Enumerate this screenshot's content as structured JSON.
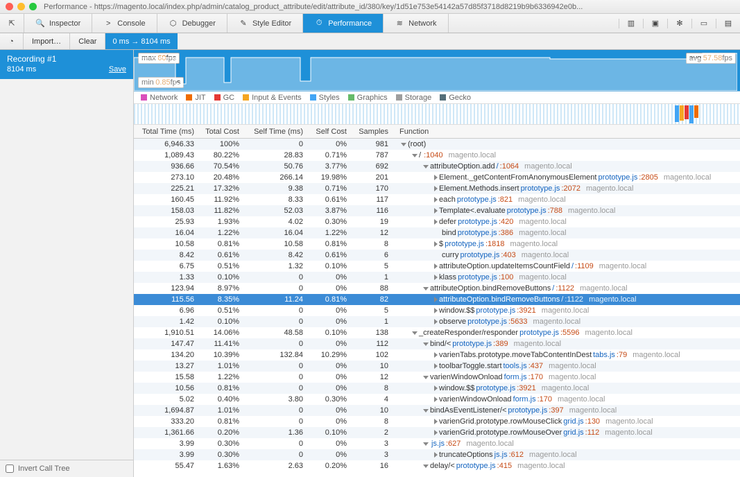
{
  "title": "Performance - https://magento.local/index.php/admin/catalog_product_attribute/edit/attribute_id/380/key/1d51e753e54142a57d85f3718d8219b9b6336942e0b...",
  "tabs": [
    "Inspector",
    "Console",
    "Debugger",
    "Style Editor",
    "Performance",
    "Network"
  ],
  "activeTab": 4,
  "bar2": {
    "import": "Import…",
    "clear": "Clear",
    "range": "0 ms → 8104 ms"
  },
  "recording": {
    "name": "Recording #1",
    "duration": "8104 ms",
    "save": "Save"
  },
  "fps": {
    "max_label": "max",
    "max": "60",
    "min_label": "min",
    "min": "0.85",
    "avg_label": "avg",
    "avg": "57.58",
    "unit": "fps"
  },
  "legend": [
    {
      "c": "#d94fbb",
      "t": "Network"
    },
    {
      "c": "#ef6c00",
      "t": "JIT"
    },
    {
      "c": "#e53935",
      "t": "GC"
    },
    {
      "c": "#f5a623",
      "t": "Input & Events"
    },
    {
      "c": "#42a5f5",
      "t": "Styles"
    },
    {
      "c": "#66bb6a",
      "t": "Graphics"
    },
    {
      "c": "#9e9e9e",
      "t": "Storage"
    },
    {
      "c": "#546e7a",
      "t": "Gecko"
    }
  ],
  "columns": [
    "Total Time (ms)",
    "Total Cost",
    "Self Time (ms)",
    "Self Cost",
    "Samples",
    "Function"
  ],
  "rows": [
    {
      "tt": "6,946.33",
      "tc": "100%",
      "st": "0",
      "sc": "0%",
      "sm": "981",
      "ind": 0,
      "arr": "down",
      "fn": "(root)"
    },
    {
      "tt": "1,089.43",
      "tc": "80.22%",
      "st": "28.83",
      "sc": "0.71%",
      "sm": "787",
      "ind": 1,
      "arr": "down",
      "fn": "/",
      "src": "",
      "ln": ":1040",
      "host": "magento.local"
    },
    {
      "tt": "936.66",
      "tc": "70.54%",
      "st": "50.76",
      "sc": "3.77%",
      "sm": "692",
      "ind": 2,
      "arr": "down",
      "fn": "attributeOption.add ",
      "src": "/",
      "ln": ":1064",
      "host": "magento.local"
    },
    {
      "tt": "273.10",
      "tc": "20.48%",
      "st": "266.14",
      "sc": "19.98%",
      "sm": "201",
      "ind": 3,
      "arr": "right",
      "fn": "Element._getContentFromAnonymousElement ",
      "src": "prototype.js",
      "ln": ":2805",
      "host": "magento.local"
    },
    {
      "tt": "225.21",
      "tc": "17.32%",
      "st": "9.38",
      "sc": "0.71%",
      "sm": "170",
      "ind": 3,
      "arr": "right",
      "fn": "Element.Methods.insert ",
      "src": "prototype.js",
      "ln": ":2072",
      "host": "magento.local"
    },
    {
      "tt": "160.45",
      "tc": "11.92%",
      "st": "8.33",
      "sc": "0.61%",
      "sm": "117",
      "ind": 3,
      "arr": "right",
      "fn": "each ",
      "src": "prototype.js",
      "ln": ":821",
      "host": "magento.local"
    },
    {
      "tt": "158.03",
      "tc": "11.82%",
      "st": "52.03",
      "sc": "3.87%",
      "sm": "116",
      "ind": 3,
      "arr": "right",
      "fn": "Template<.evaluate ",
      "src": "prototype.js",
      "ln": ":788",
      "host": "magento.local"
    },
    {
      "tt": "25.93",
      "tc": "1.93%",
      "st": "4.02",
      "sc": "0.30%",
      "sm": "19",
      "ind": 3,
      "arr": "right",
      "fn": "defer ",
      "src": "prototype.js",
      "ln": ":420",
      "host": "magento.local"
    },
    {
      "tt": "16.04",
      "tc": "1.22%",
      "st": "16.04",
      "sc": "1.22%",
      "sm": "12",
      "ind": 3,
      "arr": "",
      "fn": "bind ",
      "src": "prototype.js",
      "ln": ":386",
      "host": "magento.local"
    },
    {
      "tt": "10.58",
      "tc": "0.81%",
      "st": "10.58",
      "sc": "0.81%",
      "sm": "8",
      "ind": 3,
      "arr": "right",
      "fn": "$ ",
      "src": "prototype.js",
      "ln": ":1818",
      "host": "magento.local"
    },
    {
      "tt": "8.42",
      "tc": "0.61%",
      "st": "8.42",
      "sc": "0.61%",
      "sm": "6",
      "ind": 3,
      "arr": "",
      "fn": "curry ",
      "src": "prototype.js",
      "ln": ":403",
      "host": "magento.local"
    },
    {
      "tt": "6.75",
      "tc": "0.51%",
      "st": "1.32",
      "sc": "0.10%",
      "sm": "5",
      "ind": 3,
      "arr": "right",
      "fn": "attributeOption.updateItemsCountField ",
      "src": "/",
      "ln": ":1109",
      "host": "magento.local"
    },
    {
      "tt": "1.33",
      "tc": "0.10%",
      "st": "0",
      "sc": "0%",
      "sm": "1",
      "ind": 3,
      "arr": "right",
      "fn": "klass ",
      "src": "prototype.js",
      "ln": ":100",
      "host": "magento.local"
    },
    {
      "tt": "123.94",
      "tc": "8.97%",
      "st": "0",
      "sc": "0%",
      "sm": "88",
      "ind": 2,
      "arr": "down",
      "fn": "attributeOption.bindRemoveButtons ",
      "src": "/",
      "ln": ":1122",
      "host": "magento.local"
    },
    {
      "tt": "115.56",
      "tc": "8.35%",
      "st": "11.24",
      "sc": "0.81%",
      "sm": "82",
      "ind": 3,
      "arr": "right",
      "fn": "attributeOption.bindRemoveButtons ",
      "src": "/",
      "ln": ":1122",
      "host": "magento.local",
      "sel": true
    },
    {
      "tt": "6.96",
      "tc": "0.51%",
      "st": "0",
      "sc": "0%",
      "sm": "5",
      "ind": 3,
      "arr": "right",
      "fn": "window.$$ ",
      "src": "prototype.js",
      "ln": ":3921",
      "host": "magento.local"
    },
    {
      "tt": "1.42",
      "tc": "0.10%",
      "st": "0",
      "sc": "0%",
      "sm": "1",
      "ind": 3,
      "arr": "right",
      "fn": "observe ",
      "src": "prototype.js",
      "ln": ":5633",
      "host": "magento.local"
    },
    {
      "tt": "1,910.51",
      "tc": "14.06%",
      "st": "48.58",
      "sc": "0.10%",
      "sm": "138",
      "ind": 1,
      "arr": "down",
      "fn": "_createResponder/responder ",
      "src": "prototype.js",
      "ln": ":5596",
      "host": "magento.local"
    },
    {
      "tt": "147.47",
      "tc": "11.41%",
      "st": "0",
      "sc": "0%",
      "sm": "112",
      "ind": 2,
      "arr": "down",
      "fn": "bind/< ",
      "src": "prototype.js",
      "ln": ":389",
      "host": "magento.local"
    },
    {
      "tt": "134.20",
      "tc": "10.39%",
      "st": "132.84",
      "sc": "10.29%",
      "sm": "102",
      "ind": 3,
      "arr": "right",
      "fn": "varienTabs.prototype.moveTabContentInDest ",
      "src": "tabs.js",
      "ln": ":79",
      "host": "magento.local"
    },
    {
      "tt": "13.27",
      "tc": "1.01%",
      "st": "0",
      "sc": "0%",
      "sm": "10",
      "ind": 3,
      "arr": "right",
      "fn": "toolbarToggle.start ",
      "src": "tools.js",
      "ln": ":437",
      "host": "magento.local"
    },
    {
      "tt": "15.58",
      "tc": "1.22%",
      "st": "0",
      "sc": "0%",
      "sm": "12",
      "ind": 2,
      "arr": "down",
      "fn": "varienWindowOnload ",
      "src": "form.js",
      "ln": ":170",
      "host": "magento.local"
    },
    {
      "tt": "10.56",
      "tc": "0.81%",
      "st": "0",
      "sc": "0%",
      "sm": "8",
      "ind": 3,
      "arr": "right",
      "fn": "window.$$ ",
      "src": "prototype.js",
      "ln": ":3921",
      "host": "magento.local"
    },
    {
      "tt": "5.02",
      "tc": "0.40%",
      "st": "3.80",
      "sc": "0.30%",
      "sm": "4",
      "ind": 3,
      "arr": "right",
      "fn": "varienWindowOnload ",
      "src": "form.js",
      "ln": ":170",
      "host": "magento.local"
    },
    {
      "tt": "1,694.87",
      "tc": "1.01%",
      "st": "0",
      "sc": "0%",
      "sm": "10",
      "ind": 2,
      "arr": "down",
      "fn": "bindAsEventListener/< ",
      "src": "prototype.js",
      "ln": ":397",
      "host": "magento.local"
    },
    {
      "tt": "333.20",
      "tc": "0.81%",
      "st": "0",
      "sc": "0%",
      "sm": "8",
      "ind": 3,
      "arr": "right",
      "fn": "varienGrid.prototype.rowMouseClick ",
      "src": "grid.js",
      "ln": ":130",
      "host": "magento.local"
    },
    {
      "tt": "1,361.66",
      "tc": "0.20%",
      "st": "1.36",
      "sc": "0.10%",
      "sm": "2",
      "ind": 3,
      "arr": "right",
      "fn": "varienGrid.prototype.rowMouseOver ",
      "src": "grid.js",
      "ln": ":112",
      "host": "magento.local"
    },
    {
      "tt": "3.99",
      "tc": "0.30%",
      "st": "0",
      "sc": "0%",
      "sm": "3",
      "ind": 2,
      "arr": "down",
      "fn": "",
      "src": "js.js",
      "ln": ":627",
      "host": "magento.local"
    },
    {
      "tt": "3.99",
      "tc": "0.30%",
      "st": "0",
      "sc": "0%",
      "sm": "3",
      "ind": 3,
      "arr": "right",
      "fn": "truncateOptions ",
      "src": "js.js",
      "ln": ":612",
      "host": "magento.local"
    },
    {
      "tt": "55.47",
      "tc": "1.63%",
      "st": "2.63",
      "sc": "0.20%",
      "sm": "16",
      "ind": 2,
      "arr": "down",
      "fn": "delay/< ",
      "src": "prototype.js",
      "ln": ":415",
      "host": "magento.local"
    }
  ],
  "invert": "Invert Call Tree"
}
